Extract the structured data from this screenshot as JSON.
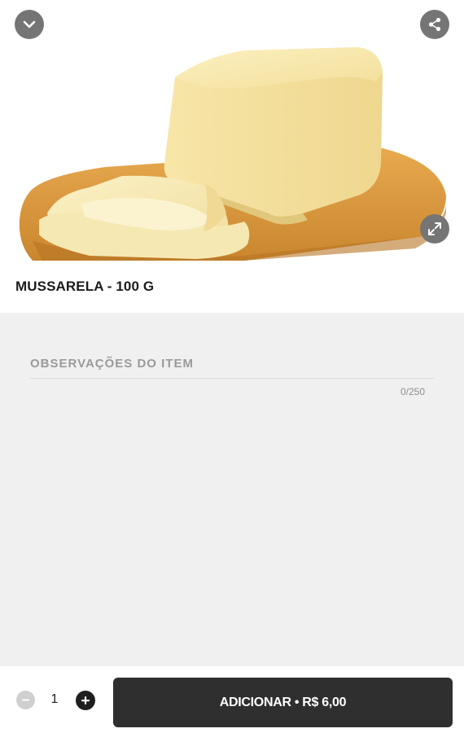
{
  "product": {
    "title": "MUSSARELA - 100 G",
    "image_icon": "mozzarella-cheese-image"
  },
  "header": {
    "collapse_icon": "chevron-down-icon",
    "share_icon": "share-icon",
    "expand_icon": "expand-icon"
  },
  "observations": {
    "placeholder": "OBSERVAÇÕES DO ITEM",
    "value": "",
    "counter": "0/250"
  },
  "footer": {
    "quantity": "1",
    "minus_icon": "minus-icon",
    "plus_icon": "plus-icon",
    "add_label": "ADICIONAR • R$ 6,00"
  },
  "colors": {
    "button_dark": "#2f2f2f",
    "icon_button": "#757575",
    "panel_gray": "#f0f0f0"
  }
}
